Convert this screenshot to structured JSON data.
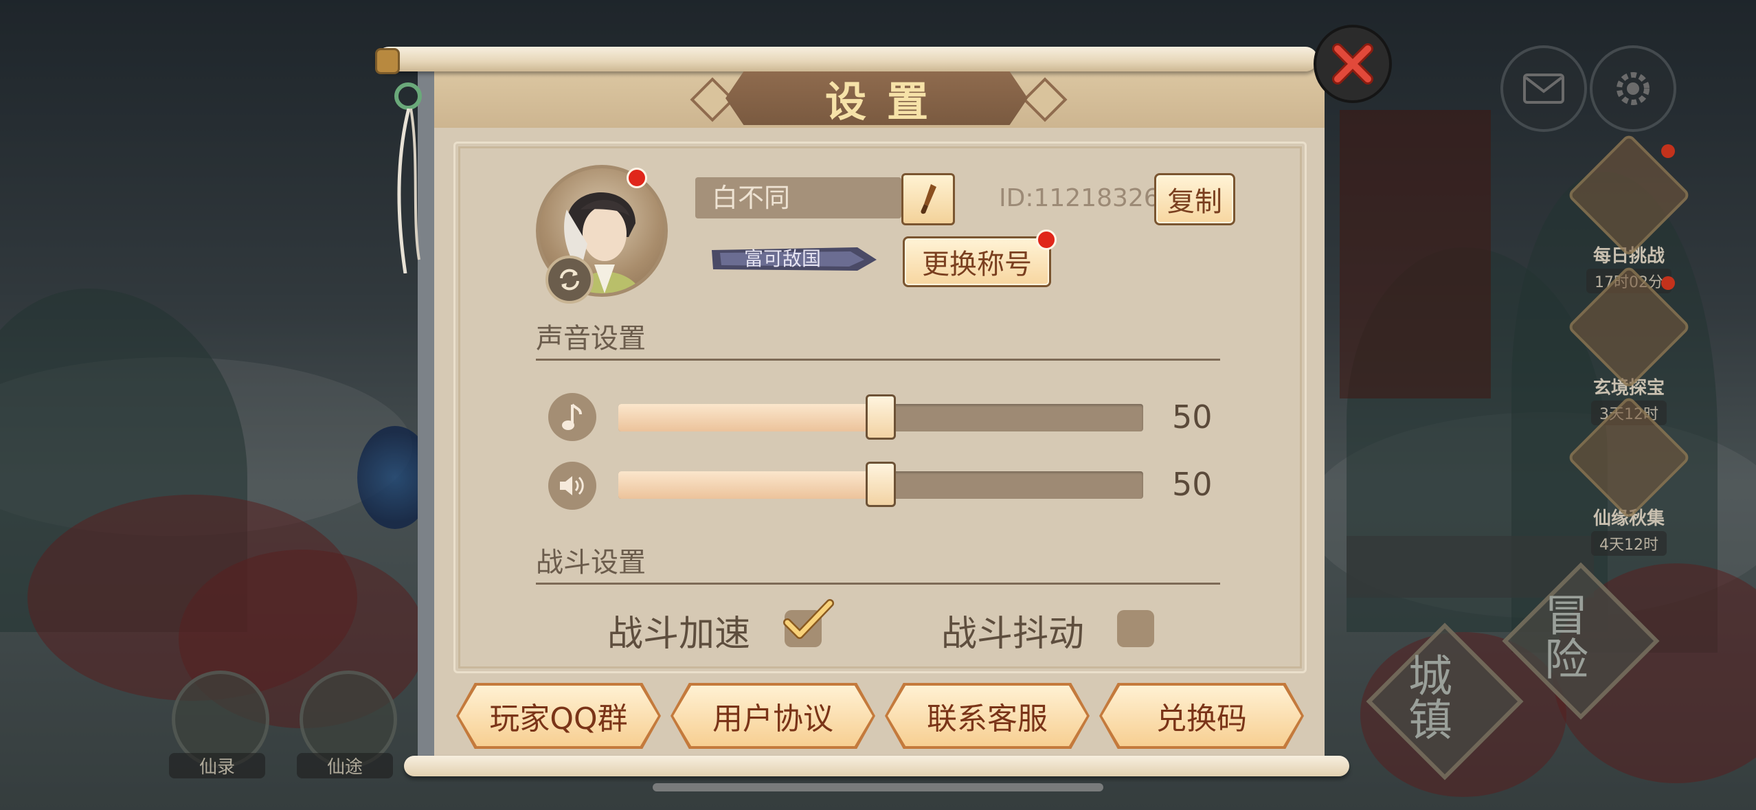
{
  "dialog": {
    "title": "设置",
    "close_icon": "close-x-icon"
  },
  "profile": {
    "name": "白不同",
    "id_text": "ID:11218326",
    "copy_label": "复制",
    "change_title_label": "更换称号",
    "title_badge_text": "富可敌国",
    "edit_icon": "brush-icon",
    "swap_icon": "refresh-icon"
  },
  "sound": {
    "section_title": "声音设置",
    "music": {
      "icon": "music-note-icon",
      "value": 50,
      "value_text": "50"
    },
    "effects": {
      "icon": "speaker-icon",
      "value": 50,
      "value_text": "50"
    }
  },
  "battle": {
    "section_title": "战斗设置",
    "speedup": {
      "label": "战斗加速",
      "checked": true
    },
    "shake": {
      "label": "战斗抖动",
      "checked": false
    }
  },
  "bottom_buttons": [
    "玩家QQ群",
    "用户协议",
    "联系客服",
    "兑换码"
  ],
  "hud": {
    "mail_icon": "mail-icon",
    "settings_icon": "gear-icon",
    "events": [
      {
        "title": "每日挑战",
        "timer": "17时02分",
        "has_dot": true
      },
      {
        "title": "玄境探宝",
        "timer": "3天12时",
        "has_dot": true
      },
      {
        "title": "仙缘秋集",
        "timer": "4天12时",
        "has_dot": false
      }
    ],
    "town_label": "城镇",
    "adventure_label": "冒险",
    "bottom_left": [
      {
        "label": "仙录"
      },
      {
        "label": "仙途"
      }
    ]
  },
  "colors": {
    "accent_red": "#e0261a",
    "button_text": "#7a3418",
    "panel_bg": "#d6c9b4",
    "title_text": "#f6e2a8"
  }
}
